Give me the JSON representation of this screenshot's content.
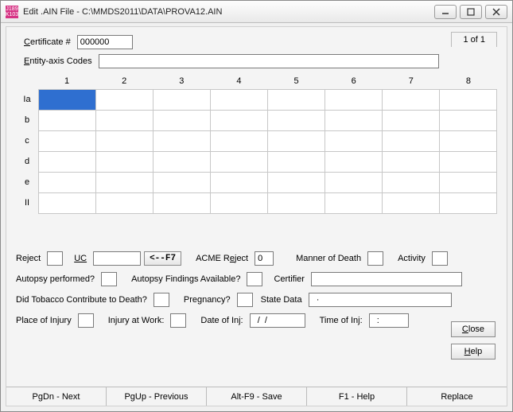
{
  "window": {
    "title": "Edit .AIN File - C:\\MMDS2011\\DATA\\PROVA12.AIN",
    "icon_text": "J189 K103"
  },
  "pager": "1 of 1",
  "labels": {
    "certificate": "Certificate #",
    "entity_axis": "Entity-axis Codes"
  },
  "certificate_value": "000000",
  "entity_axis_value": "",
  "grid": {
    "cols": [
      "1",
      "2",
      "3",
      "4",
      "5",
      "6",
      "7",
      "8"
    ],
    "rows": [
      "Ia",
      "b",
      "c",
      "d",
      "e",
      "II"
    ]
  },
  "form": {
    "reject": "Reject",
    "uc": "UC",
    "uc_value": "",
    "f7": "<--F7",
    "acme_reject": "ACME Reject",
    "acme_reject_value": "0",
    "manner": "Manner of Death",
    "activity": "Activity",
    "autopsy_perf": "Autopsy performed?",
    "autopsy_find": "Autopsy Findings Available?",
    "certifier": "Certifier",
    "certifier_value": "",
    "tobacco": "Did Tobacco Contribute to Death?",
    "pregnancy": "Pregnancy?",
    "state_data": "State Data",
    "state_data_value": "  ·",
    "place_injury": "Place of Injury",
    "injury_work": "Injury at Work:",
    "date_inj": "Date of Inj:",
    "date_inj_value": "  /  /",
    "time_inj": "Time of Inj:",
    "time_inj_value": "  :"
  },
  "buttons": {
    "close": "Close",
    "help": "Help"
  },
  "status": {
    "pgdn": "PgDn - Next",
    "pgup": "PgUp - Previous",
    "save": "Alt-F9 - Save",
    "f1": "F1 - Help",
    "replace": "Replace"
  }
}
